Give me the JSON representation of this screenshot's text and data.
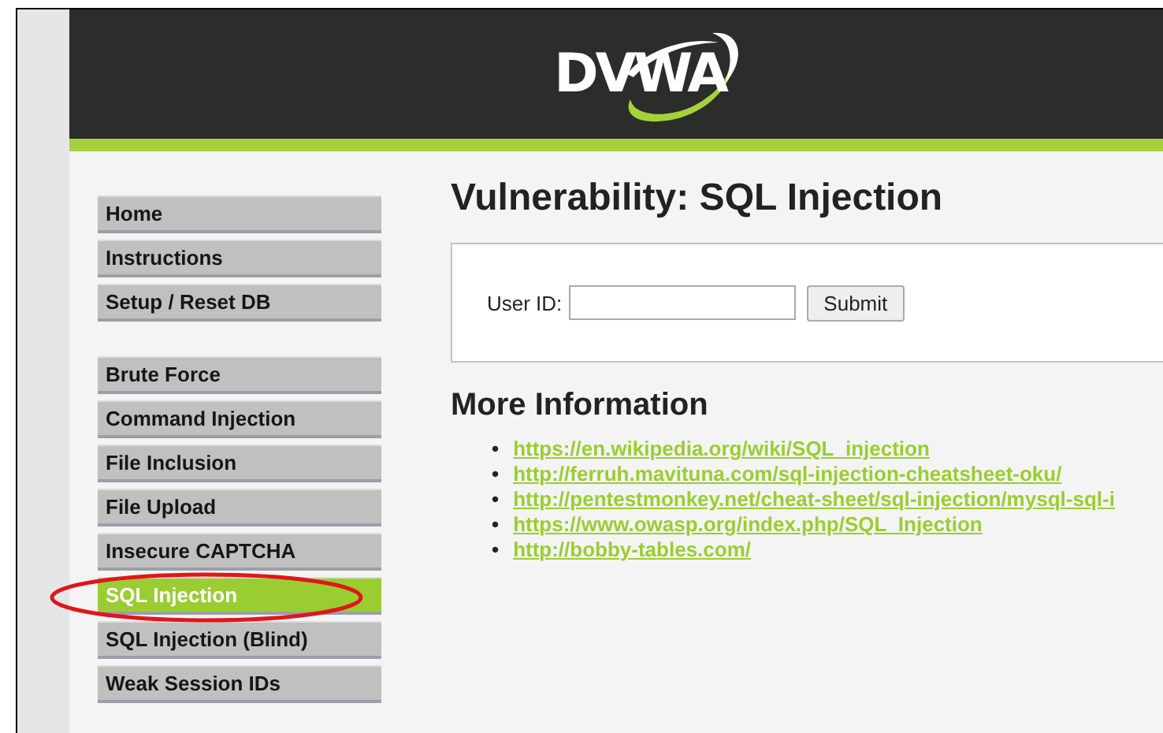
{
  "header": {
    "logo": "DVWA"
  },
  "menu": {
    "groups": [
      [
        {
          "label": "Home",
          "selected": false
        },
        {
          "label": "Instructions",
          "selected": false
        },
        {
          "label": "Setup / Reset DB",
          "selected": false
        }
      ],
      [
        {
          "label": "Brute Force",
          "selected": false
        },
        {
          "label": "Command Injection",
          "selected": false
        },
        {
          "label": "File Inclusion",
          "selected": false
        },
        {
          "label": "File Upload",
          "selected": false
        },
        {
          "label": "Insecure CAPTCHA",
          "selected": false
        },
        {
          "label": "SQL Injection",
          "selected": true
        },
        {
          "label": "SQL Injection (Blind)",
          "selected": false
        },
        {
          "label": "Weak Session IDs",
          "selected": false
        }
      ]
    ]
  },
  "main": {
    "title": "Vulnerability: SQL Injection",
    "form": {
      "label": "User ID:",
      "submit": "Submit"
    },
    "more_title": "More Information",
    "links": [
      {
        "marker": "•",
        "url": "https://en.wikipedia.org/wiki/SQL_injection"
      },
      {
        "marker": "•",
        "url": "http://ferruh.mavituna.com/sql-injection-cheatsheet-oku/"
      },
      {
        "marker": "•",
        "url": "http://pentestmonkey.net/cheat-sheet/sql-injection/mysql-sql-i"
      },
      {
        "marker": "•",
        "url": "https://www.owasp.org/index.php/SQL_Injection"
      },
      {
        "marker": "•",
        "url": "http://bobby-tables.com/"
      }
    ]
  }
}
